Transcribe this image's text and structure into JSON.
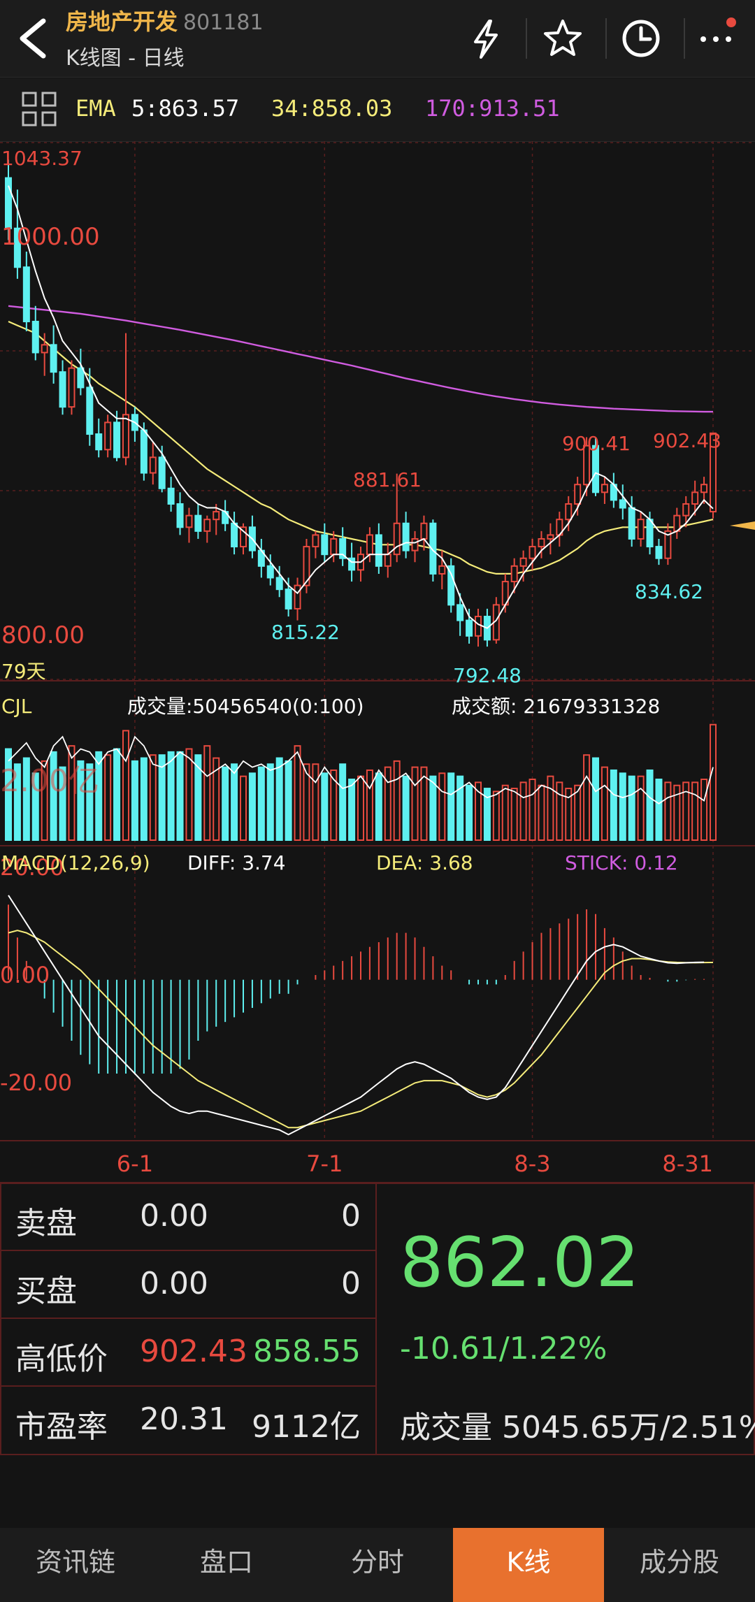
{
  "header": {
    "title": "房地产开发",
    "code": "801181",
    "subtitle": "K线图 - 日线",
    "icons": [
      "back-arrow-icon",
      "lightning-icon",
      "star-icon",
      "clock-icon",
      "more-icon"
    ]
  },
  "ema": {
    "label": "EMA",
    "ema5": "5:863.57",
    "ema34": "34:858.03",
    "ema170": "170:913.51",
    "colors": {
      "ema5": "#ffffff",
      "ema34": "#f5ec7a",
      "ema170": "#d05ce0"
    }
  },
  "price_panel": {
    "axis_top": "1043.37",
    "axis_1000": "1000.00",
    "axis_800": "800.00",
    "period_label": "79天",
    "annotations": {
      "a": "881.61",
      "b": "815.22",
      "c": "792.48",
      "d": "900.41",
      "e": "902.43",
      "f": "834.62"
    }
  },
  "volume_panel": {
    "label": "CJL",
    "volume_text": "成交量:50456540(0:100)",
    "amount_text": "成交额: 21679331328",
    "axis_label": "2.00亿"
  },
  "macd_panel": {
    "label": "MACD(12,26,9)",
    "diff": "DIFF: 3.74",
    "dea": "DEA: 3.68",
    "stick": "STICK: 0.12",
    "axis_20": "20.00",
    "axis_0": "0.00",
    "axis_m20": "-20.00"
  },
  "x_axis": {
    "ticks": [
      "6-1",
      "7-1",
      "8-3",
      "8-31"
    ]
  },
  "quote": {
    "sell_label": "卖盘",
    "sell_price": "0.00",
    "sell_vol": "0",
    "buy_label": "买盘",
    "buy_price": "0.00",
    "buy_vol": "0",
    "hilo_label": "高低价",
    "high": "902.43",
    "low": "858.55",
    "pe_label": "市盈率",
    "pe": "20.31",
    "mktcap": "9112亿",
    "last": "862.02",
    "change": "-10.61/1.22%",
    "vol_label": "成交量",
    "vol_value": "5045.65万/2.51%"
  },
  "tabs": [
    {
      "label": "资讯链",
      "active": false
    },
    {
      "label": "盘口",
      "active": false
    },
    {
      "label": "分时",
      "active": false
    },
    {
      "label": "K线",
      "active": true
    },
    {
      "label": "成分股",
      "active": false
    }
  ],
  "colors": {
    "up": "#e84a3f",
    "down": "#5ef0f0",
    "accent": "#e8712e",
    "price_green": "#66e070"
  },
  "chart_data": {
    "type": "candlestick",
    "title": "",
    "x_ticks": [
      "6-1",
      "7-1",
      "8-3",
      "8-31"
    ],
    "x_tick_index": [
      14,
      35,
      58,
      78
    ],
    "ylim": [
      790,
      1045
    ],
    "candles": [
      [
        1034,
        1043.37,
        1002,
        1008
      ],
      [
        1008,
        1028,
        982,
        988
      ],
      [
        988,
        996,
        955,
        960
      ],
      [
        960,
        968,
        940,
        944
      ],
      [
        944,
        954,
        932,
        948
      ],
      [
        948,
        958,
        928,
        934
      ],
      [
        934,
        940,
        912,
        916
      ],
      [
        916,
        940,
        912,
        936
      ],
      [
        936,
        946,
        922,
        926
      ],
      [
        926,
        936,
        896,
        902
      ],
      [
        902,
        910,
        890,
        894
      ],
      [
        894,
        912,
        890,
        908
      ],
      [
        908,
        914,
        888,
        890
      ],
      [
        890,
        954,
        886,
        912
      ],
      [
        912,
        916,
        898,
        904
      ],
      [
        904,
        908,
        878,
        882
      ],
      [
        882,
        898,
        876,
        890
      ],
      [
        890,
        896,
        872,
        874
      ],
      [
        874,
        880,
        862,
        866
      ],
      [
        866,
        872,
        850,
        854
      ],
      [
        854,
        864,
        846,
        860
      ],
      [
        860,
        866,
        848,
        852
      ],
      [
        852,
        860,
        846,
        858
      ],
      [
        858,
        866,
        850,
        862
      ],
      [
        862,
        868,
        852,
        856
      ],
      [
        856,
        862,
        840,
        844
      ],
      [
        844,
        856,
        840,
        854
      ],
      [
        854,
        860,
        838,
        842
      ],
      [
        842,
        848,
        828,
        834
      ],
      [
        834,
        840,
        824,
        828
      ],
      [
        828,
        834,
        818,
        822
      ],
      [
        822,
        828,
        808,
        812
      ],
      [
        812,
        828,
        806,
        824
      ],
      [
        824,
        848,
        820,
        844
      ],
      [
        844,
        852,
        838,
        850
      ],
      [
        850,
        856,
        836,
        840
      ],
      [
        840,
        852,
        836,
        848
      ],
      [
        848,
        854,
        834,
        838
      ],
      [
        838,
        846,
        826,
        832
      ],
      [
        832,
        844,
        826,
        840
      ],
      [
        840,
        854,
        836,
        850
      ],
      [
        850,
        856,
        830,
        834
      ],
      [
        834,
        846,
        828,
        840
      ],
      [
        840,
        881.61,
        836,
        856
      ],
      [
        856,
        862,
        838,
        842
      ],
      [
        842,
        852,
        836,
        848
      ],
      [
        848,
        860,
        842,
        856
      ],
      [
        856,
        858,
        826,
        830
      ],
      [
        830,
        842,
        822,
        834
      ],
      [
        834,
        838,
        810,
        814
      ],
      [
        814,
        820,
        798,
        806
      ],
      [
        806,
        812,
        794,
        798
      ],
      [
        798,
        812,
        792.48,
        808
      ],
      [
        808,
        812,
        792.48,
        796
      ],
      [
        796,
        818,
        794,
        814
      ],
      [
        814,
        830,
        810,
        826
      ],
      [
        826,
        838,
        820,
        834
      ],
      [
        834,
        842,
        826,
        838
      ],
      [
        838,
        848,
        832,
        844
      ],
      [
        844,
        852,
        838,
        848
      ],
      [
        848,
        856,
        840,
        850
      ],
      [
        850,
        862,
        844,
        858
      ],
      [
        858,
        870,
        852,
        866
      ],
      [
        866,
        880,
        860,
        876
      ],
      [
        876,
        900.41,
        870,
        896
      ],
      [
        896,
        900,
        870,
        872
      ],
      [
        872,
        880,
        866,
        876
      ],
      [
        876,
        882,
        864,
        868
      ],
      [
        868,
        876,
        858,
        864
      ],
      [
        864,
        870,
        844,
        848
      ],
      [
        848,
        862,
        844,
        858
      ],
      [
        858,
        862,
        840,
        844
      ],
      [
        844,
        848,
        834.62,
        838
      ],
      [
        838,
        856,
        834.62,
        852
      ],
      [
        852,
        864,
        848,
        860
      ],
      [
        860,
        870,
        854,
        866
      ],
      [
        866,
        878,
        860,
        872
      ],
      [
        872,
        880,
        866,
        876
      ],
      [
        862.02,
        902.43,
        858.55,
        902.43
      ]
    ],
    "ema5": [
      1030,
      1018,
      1002,
      986,
      972,
      962,
      950,
      944,
      938,
      928,
      918,
      914,
      910,
      910,
      908,
      904,
      898,
      892,
      884,
      876,
      870,
      866,
      864,
      864,
      862,
      856,
      852,
      848,
      842,
      836,
      830,
      824,
      820,
      826,
      832,
      836,
      840,
      840,
      836,
      836,
      840,
      840,
      840,
      844,
      846,
      846,
      848,
      842,
      838,
      830,
      818,
      808,
      804,
      802,
      806,
      814,
      822,
      830,
      836,
      842,
      846,
      850,
      856,
      864,
      874,
      882,
      880,
      876,
      870,
      864,
      862,
      858,
      852,
      850,
      852,
      856,
      862,
      868,
      863.57
    ],
    "ema34": [
      960,
      958,
      956,
      954,
      950,
      946,
      942,
      938,
      935,
      932,
      928,
      925,
      922,
      919,
      916,
      912,
      908,
      904,
      900,
      896,
      892,
      888,
      884,
      881,
      878,
      875,
      872,
      869,
      866,
      864,
      861,
      858,
      856,
      854,
      852,
      851,
      850,
      849,
      848,
      847,
      846,
      845,
      845,
      845,
      845,
      845,
      844,
      843,
      842,
      840,
      838,
      835,
      833,
      831,
      830,
      830,
      830,
      831,
      832,
      833,
      835,
      837,
      840,
      843,
      847,
      850,
      852,
      853,
      854,
      854,
      854,
      854,
      854,
      854,
      854,
      855,
      856,
      857,
      858.03
    ],
    "ema170": [
      968,
      967.5,
      967,
      966.5,
      966,
      965.5,
      965,
      964.5,
      964,
      963.3,
      962.6,
      961.9,
      961.2,
      960.5,
      959.7,
      958.9,
      958.1,
      957.3,
      956.5,
      955.7,
      954.8,
      953.9,
      953,
      952.1,
      951.2,
      950.3,
      949.3,
      948.3,
      947.3,
      946.3,
      945.3,
      944.3,
      943.3,
      942.3,
      941.3,
      940.3,
      939.3,
      938.3,
      937.3,
      936.2,
      935.1,
      934,
      932.9,
      931.8,
      930.7,
      929.7,
      928.7,
      927.7,
      926.7,
      925.7,
      924.8,
      923.9,
      923,
      922.2,
      921.4,
      920.7,
      920,
      919.4,
      918.8,
      918.2,
      917.7,
      917.2,
      916.8,
      916.4,
      916,
      915.7,
      915.4,
      915.1,
      914.9,
      914.7,
      914.5,
      914.3,
      914.1,
      913.9,
      913.8,
      913.7,
      913.6,
      913.5,
      913.51
    ],
    "volume": [
      1.5,
      1.25,
      1.35,
      1.1,
      1.3,
      1.45,
      1.2,
      1.55,
      1.3,
      1.25,
      1.45,
      1.4,
      1.5,
      1.8,
      1.3,
      1.35,
      1.4,
      1.4,
      1.45,
      1.45,
      1.5,
      1.4,
      1.55,
      1.35,
      1.2,
      1.25,
      1.05,
      1.1,
      1.2,
      1.25,
      1.35,
      1.3,
      1.55,
      1.25,
      1.25,
      1.1,
      1.15,
      1.25,
      1.0,
      1.05,
      1.15,
      1.1,
      1.2,
      1.3,
      1.05,
      1.2,
      1.2,
      1.05,
      1.1,
      1.1,
      1.05,
      0.9,
      0.95,
      0.85,
      0.8,
      0.9,
      0.85,
      0.95,
      1.0,
      0.9,
      1.05,
      0.95,
      0.85,
      0.9,
      1.4,
      1.35,
      1.2,
      1.15,
      1.1,
      1.05,
      1.05,
      1.15,
      1.0,
      0.95,
      0.9,
      0.95,
      0.95,
      1.0,
      1.9
    ],
    "volume_ma": [
      1.3,
      1.45,
      1.6,
      1.35,
      1.2,
      1.55,
      1.7,
      1.35,
      1.5,
      1.45,
      1.25,
      1.45,
      1.5,
      1.3,
      1.7,
      1.55,
      1.25,
      1.2,
      1.3,
      1.45,
      1.35,
      1.2,
      1.05,
      1.15,
      1.25,
      1.1,
      1.3,
      1.2,
      1.25,
      1.15,
      1.2,
      1.3,
      1.45,
      1.1,
      0.95,
      1.2,
      1.0,
      0.85,
      0.9,
      1.05,
      0.85,
      1.15,
      0.95,
      1.0,
      1.1,
      0.9,
      1.05,
      0.95,
      0.8,
      0.75,
      0.85,
      0.95,
      0.8,
      0.7,
      0.75,
      0.85,
      0.8,
      0.7,
      0.75,
      0.9,
      0.85,
      0.75,
      0.7,
      0.8,
      1.05,
      0.8,
      0.9,
      0.75,
      0.7,
      0.75,
      0.85,
      0.7,
      0.6,
      0.7,
      0.75,
      0.8,
      0.75,
      0.65,
      1.2
    ],
    "volume_ylim": [
      0,
      2.0
    ],
    "diff": [
      18,
      15,
      12,
      9,
      6,
      3,
      0,
      -3,
      -6,
      -9,
      -12,
      -14,
      -16,
      -18,
      -20,
      -22,
      -24,
      -25.5,
      -27,
      -28,
      -28.5,
      -28,
      -28,
      -28.5,
      -29,
      -29.5,
      -30,
      -30.5,
      -31,
      -31.5,
      -32,
      -33,
      -32,
      -31,
      -30,
      -29,
      -28,
      -27,
      -26,
      -25,
      -23.5,
      -22,
      -20.5,
      -19,
      -18,
      -17.5,
      -18,
      -19,
      -20,
      -21,
      -22.5,
      -24,
      -25,
      -25.5,
      -25,
      -23,
      -20,
      -17,
      -14,
      -11,
      -8,
      -5,
      -2,
      1,
      4,
      6,
      7,
      7.5,
      7,
      6,
      5,
      4.5,
      4,
      3.6,
      3.5,
      3.6,
      3.7,
      3.74
    ],
    "dea": [
      10,
      10.5,
      10,
      9,
      8,
      6.5,
      5,
      3.5,
      2,
      0,
      -2,
      -4,
      -6,
      -8,
      -10,
      -12,
      -14,
      -15.5,
      -17,
      -18.5,
      -20,
      -21.5,
      -22.5,
      -23.5,
      -24.5,
      -25.5,
      -26.5,
      -27.5,
      -28.5,
      -29.5,
      -30.5,
      -31.5,
      -31.5,
      -31,
      -30.5,
      -30,
      -29.5,
      -29,
      -28.5,
      -28,
      -27,
      -26,
      -25,
      -24,
      -23,
      -22,
      -21.5,
      -21.5,
      -21.5,
      -22,
      -22.5,
      -23.5,
      -24.5,
      -25,
      -24.5,
      -23.5,
      -22,
      -20,
      -18,
      -16,
      -13.5,
      -11,
      -8.5,
      -6,
      -3.5,
      -1,
      1.5,
      3,
      4,
      4.5,
      4.5,
      4.3,
      4,
      3.8,
      3.7,
      3.65,
      3.62,
      3.66,
      3.68
    ],
    "macd_ylim": [
      -34,
      22
    ],
    "stick_series": {
      "name": "STICK"
    }
  }
}
